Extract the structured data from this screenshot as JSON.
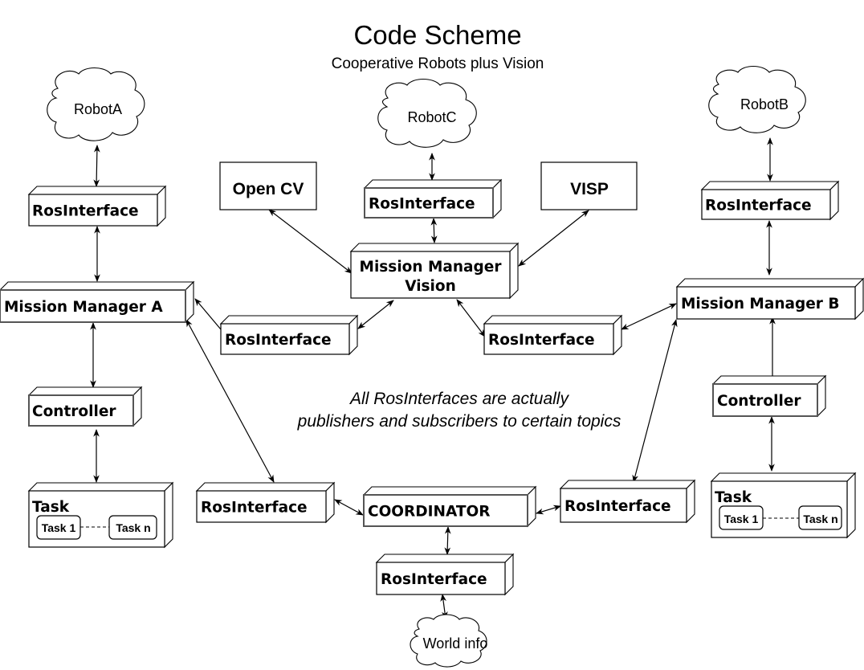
{
  "header": {
    "title": "Code Scheme",
    "subtitle": "Cooperative Robots plus Vision"
  },
  "note": {
    "line1": "All RosInterfaces are actually",
    "line2": "publishers and subscribers to certain topics"
  },
  "clouds": {
    "robot_a": "RobotA",
    "robot_c": "RobotC",
    "robot_b": "RobotB",
    "world_info": "World info"
  },
  "libraries": {
    "open_cv": "Open CV",
    "visp": "VISP"
  },
  "nodes": {
    "ros_a_top": "RosInterface",
    "ros_c_top": "RosInterface",
    "ros_b_top": "RosInterface",
    "mm_a": "Mission Manager A",
    "mm_vision_line1": "Mission Manager",
    "mm_vision_line2": "Vision",
    "mm_b": "Mission Manager B",
    "ros_vision_left": "RosInterface",
    "ros_vision_right": "RosInterface",
    "controller_a": "Controller",
    "controller_b": "Controller",
    "ros_coord_left": "RosInterface",
    "coordinator": "COORDINATOR",
    "ros_coord_right": "RosInterface",
    "ros_coord_bottom": "RosInterface"
  },
  "tasks": {
    "task_a": {
      "label": "Task",
      "first": "Task 1",
      "last": "Task n"
    },
    "task_b": {
      "label": "Task",
      "first": "Task 1",
      "last": "Task n"
    }
  }
}
